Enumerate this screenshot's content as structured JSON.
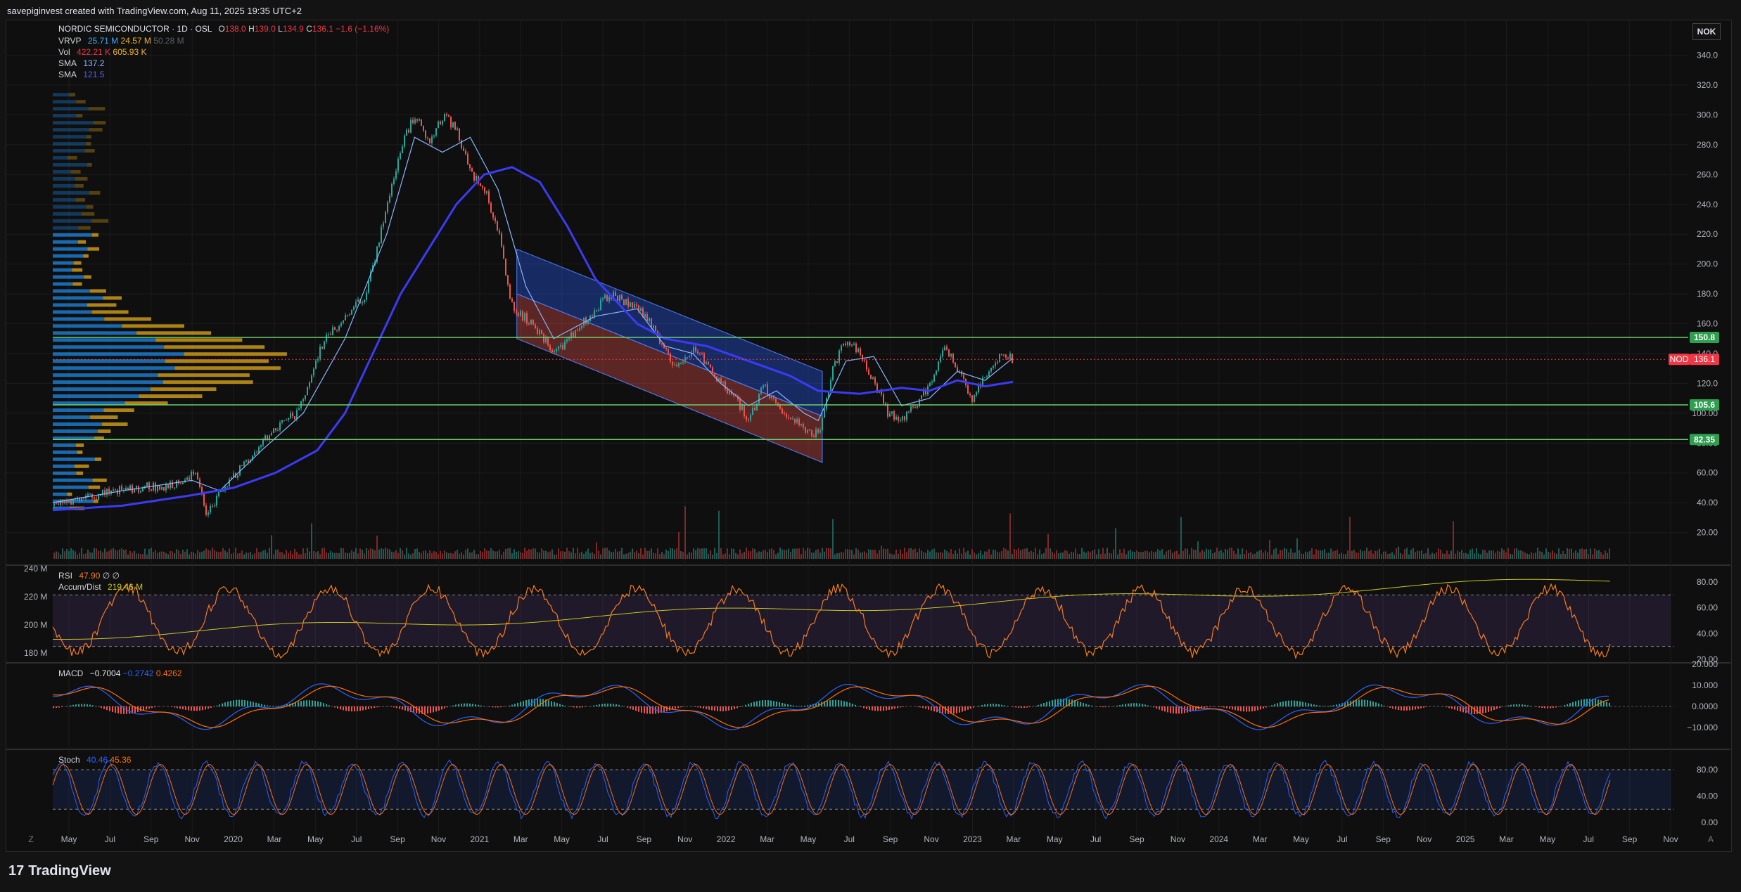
{
  "header": {
    "caption": "savepiginvest created with TradingView.com, Aug 11, 2025 19:35 UTC+2"
  },
  "currency_button": "NOK",
  "legend": {
    "title": "NORDIC SEMICONDUCTOR · 1D · OSL",
    "ohlc": {
      "o_label": "O",
      "o": "138.0",
      "h_label": "H",
      "h": "139.0",
      "l_label": "L",
      "l": "134.9",
      "c_label": "C",
      "c": "136.1",
      "chg": "−1.6 (−1.16%)"
    },
    "vrvp": {
      "label": "VRVP",
      "v1": "25.71 M",
      "v2": "24.57 M",
      "v3": "50.28 M"
    },
    "vol": {
      "label": "Vol",
      "v1": "422.21 K",
      "v2": "605.93 K"
    },
    "sma1": {
      "label": "SMA",
      "v": "137.2"
    },
    "sma2": {
      "label": "SMA",
      "v": "121.5"
    },
    "rsi": {
      "label": "RSI",
      "v1": "47.90",
      "v2": "∅",
      "v3": "∅"
    },
    "ad": {
      "label": "Accum/Dist",
      "v": "219.46 M"
    },
    "macd": {
      "label": "MACD",
      "v1": "−0.7004",
      "v2": "−0.2742",
      "v3": "0.4262"
    },
    "stoch": {
      "label": "Stoch",
      "v1": "40.46",
      "v2": "45.36"
    }
  },
  "colors": {
    "up": "#26a69a",
    "down": "#ef5350",
    "sma_fast": "#87b5ff",
    "sma_slow": "#3b3bf5",
    "level": "#6bd16b",
    "price_tag": "#f23645",
    "rsi": "#f57c1f",
    "macd": "#2962ff",
    "signal": "#ff6d00",
    "ad": "#c8c820",
    "vrvp_up": "#1e88e5",
    "vrvp_down": "#d4a017"
  },
  "chart_data": [
    {
      "type": "candlestick",
      "title": "NORDIC SEMICONDUCTOR · 1D · OSL",
      "x_ticks": [
        "May",
        "Jul",
        "Sep",
        "Nov",
        "2020",
        "Mar",
        "May",
        "Jul",
        "Sep",
        "Nov",
        "2021",
        "Mar",
        "May",
        "Jul",
        "Sep",
        "Nov",
        "2022",
        "Mar",
        "May",
        "Jul",
        "Sep",
        "Nov",
        "2023",
        "Mar",
        "May",
        "Jul",
        "Sep",
        "Nov",
        "2024",
        "Mar",
        "May",
        "Jul",
        "Sep",
        "Nov",
        "2025",
        "Mar",
        "May",
        "Jul",
        "Sep",
        "Nov"
      ],
      "y_ticks": [
        "340.0",
        "320.0",
        "300.0",
        "280.0",
        "260.0",
        "240.0",
        "220.0",
        "200.0",
        "180.0",
        "160.0",
        "140.0",
        "120.0",
        "100.00",
        "80.00",
        "60.00",
        "40.00",
        "20.00"
      ],
      "ylim": [
        0,
        345
      ],
      "price_path": [
        [
          0,
          38
        ],
        [
          60,
          45
        ],
        [
          120,
          50
        ],
        [
          180,
          52
        ],
        [
          205,
          60
        ],
        [
          220,
          32
        ],
        [
          245,
          50
        ],
        [
          300,
          80
        ],
        [
          330,
          95
        ],
        [
          350,
          100
        ],
        [
          390,
          150
        ],
        [
          420,
          165
        ],
        [
          450,
          180
        ],
        [
          480,
          240
        ],
        [
          500,
          280
        ],
        [
          520,
          300
        ],
        [
          540,
          280
        ],
        [
          560,
          300
        ],
        [
          580,
          290
        ],
        [
          600,
          260
        ],
        [
          620,
          250
        ],
        [
          640,
          220
        ],
        [
          660,
          170
        ],
        [
          690,
          160
        ],
        [
          720,
          140
        ],
        [
          760,
          160
        ],
        [
          800,
          180
        ],
        [
          840,
          170
        ],
        [
          860,
          160
        ],
        [
          880,
          140
        ],
        [
          900,
          130
        ],
        [
          920,
          145
        ],
        [
          950,
          125
        ],
        [
          980,
          110
        ],
        [
          1000,
          95
        ],
        [
          1020,
          120
        ],
        [
          1040,
          105
        ],
        [
          1060,
          95
        ],
        [
          1080,
          90
        ],
        [
          1100,
          85
        ],
        [
          1120,
          130
        ],
        [
          1140,
          150
        ],
        [
          1160,
          140
        ],
        [
          1180,
          120
        ],
        [
          1200,
          100
        ],
        [
          1220,
          95
        ],
        [
          1240,
          105
        ],
        [
          1260,
          120
        ],
        [
          1280,
          145
        ],
        [
          1300,
          130
        ],
        [
          1320,
          110
        ],
        [
          1340,
          125
        ],
        [
          1360,
          140
        ],
        [
          1380,
          136
        ]
      ],
      "sma_fast_path": [
        [
          0,
          40
        ],
        [
          100,
          48
        ],
        [
          200,
          55
        ],
        [
          240,
          48
        ],
        [
          300,
          75
        ],
        [
          360,
          100
        ],
        [
          420,
          150
        ],
        [
          480,
          220
        ],
        [
          520,
          285
        ],
        [
          560,
          275
        ],
        [
          600,
          285
        ],
        [
          640,
          250
        ],
        [
          680,
          185
        ],
        [
          720,
          150
        ],
        [
          780,
          165
        ],
        [
          840,
          170
        ],
        [
          880,
          145
        ],
        [
          920,
          140
        ],
        [
          960,
          120
        ],
        [
          1000,
          105
        ],
        [
          1040,
          115
        ],
        [
          1080,
          100
        ],
        [
          1100,
          95
        ],
        [
          1140,
          135
        ],
        [
          1180,
          138
        ],
        [
          1220,
          105
        ],
        [
          1260,
          110
        ],
        [
          1300,
          128
        ],
        [
          1340,
          122
        ],
        [
          1380,
          137
        ]
      ],
      "sma_slow_path": [
        [
          0,
          35
        ],
        [
          100,
          38
        ],
        [
          200,
          45
        ],
        [
          260,
          50
        ],
        [
          320,
          60
        ],
        [
          380,
          75
        ],
        [
          420,
          100
        ],
        [
          460,
          140
        ],
        [
          500,
          180
        ],
        [
          540,
          210
        ],
        [
          580,
          240
        ],
        [
          620,
          260
        ],
        [
          660,
          265
        ],
        [
          700,
          255
        ],
        [
          740,
          225
        ],
        [
          780,
          190
        ],
        [
          840,
          160
        ],
        [
          880,
          150
        ],
        [
          940,
          145
        ],
        [
          1000,
          135
        ],
        [
          1060,
          125
        ],
        [
          1100,
          115
        ],
        [
          1160,
          113
        ],
        [
          1220,
          117
        ],
        [
          1260,
          115
        ],
        [
          1300,
          122
        ],
        [
          1340,
          118
        ],
        [
          1380,
          121
        ]
      ],
      "levels": [
        {
          "label": "150.8",
          "value": 150.8
        },
        {
          "label": "105.6",
          "value": 105.6
        },
        {
          "label": "82.35",
          "value": 82.35
        }
      ],
      "last_price": {
        "symbol": "NOD",
        "label": "136.1",
        "value": 136.1
      },
      "channel": {
        "start_x": 667,
        "end_x": 1106,
        "upper_start": 210,
        "upper_end": 128,
        "mid_start": 180,
        "mid_end": 98,
        "lower_start": 150,
        "lower_end": 67
      }
    },
    {
      "type": "line",
      "name": "RSI",
      "y_ticks": [
        "80.00",
        "60.00",
        "40.00",
        "20.00"
      ],
      "left_ticks": [
        "240 M",
        "220 M",
        "200 M",
        "180 M"
      ],
      "bands": [
        70,
        30
      ]
    },
    {
      "type": "line",
      "name": "MACD",
      "y_ticks": [
        "20.000",
        "10.000",
        "0.0000",
        "−10.000"
      ]
    },
    {
      "type": "line",
      "name": "Stoch",
      "y_ticks": [
        "80.00",
        "40.00",
        "0.00"
      ],
      "bands": [
        80,
        20
      ]
    }
  ],
  "footer": {
    "brand": "TradingView",
    "logo_glyph": "17",
    "left_icon": "Z",
    "right_icon": "A"
  }
}
